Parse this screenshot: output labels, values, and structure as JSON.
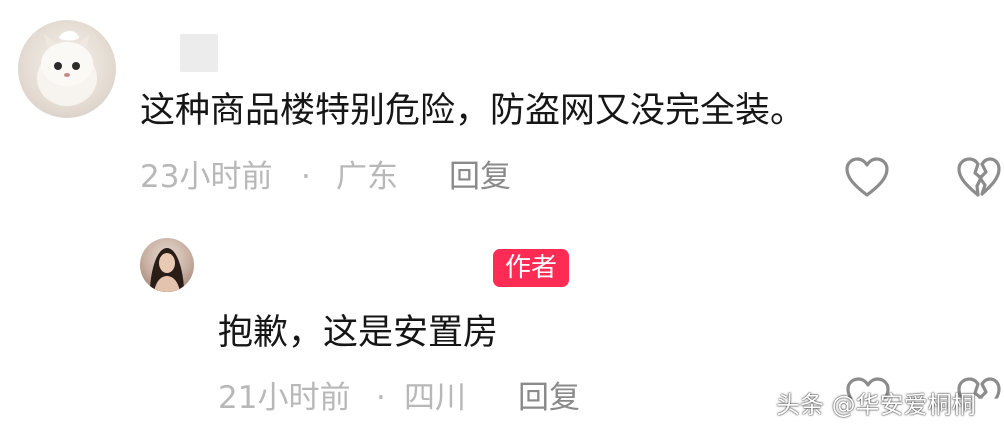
{
  "comments": [
    {
      "text": "这种商品楼特别危险，防盗网又没完全装。",
      "time": "23小时前",
      "separator": "·",
      "location": "广东",
      "reply_label": "回复",
      "avatar_icon": "cat-avatar"
    }
  ],
  "replies": [
    {
      "badge": "作者",
      "text": "抱歉，这是安置房",
      "time": "21小时前",
      "separator": "·",
      "location": "四川",
      "reply_label": "回复",
      "avatar_icon": "woman-avatar"
    }
  ],
  "icons": {
    "like": "heart-outline-icon",
    "dislike": "broken-heart-icon"
  },
  "colors": {
    "author_badge": "#fe2c55",
    "meta_text": "#b8b8b8",
    "reply_text": "#8a8a8a",
    "body_text": "#161616"
  },
  "watermark": "头条 @华安爱桐桐"
}
